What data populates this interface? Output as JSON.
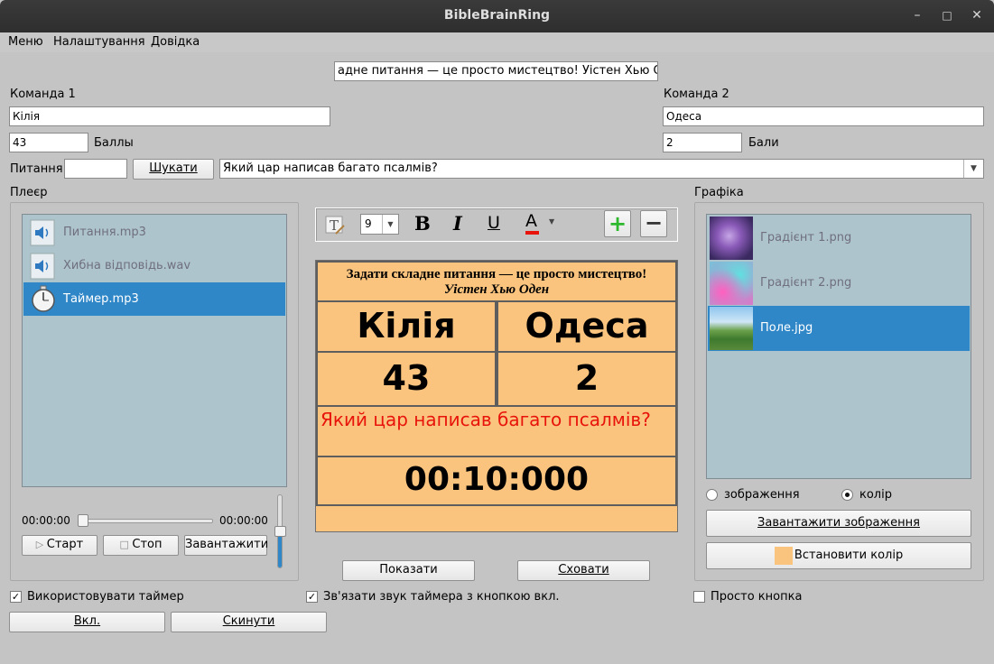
{
  "window": {
    "title": "BibleBrainRing"
  },
  "menu": [
    "Меню",
    "Налаштування",
    "Довідка"
  ],
  "quote_field": "адне питання — це просто мистецтво!  Уістен Хью Оден",
  "team1": {
    "label": "Команда 1",
    "name": "Кілія",
    "score": "43",
    "score_label": "Баллы"
  },
  "team2": {
    "label": "Команда 2",
    "name": "Одеса",
    "score": "2",
    "score_label": "Бали"
  },
  "question": {
    "label": "Питання",
    "number": "",
    "search_button": "Шукати",
    "text": "Який цар написав багато псалмів?"
  },
  "player": {
    "label": "Плеєр",
    "files": [
      {
        "name": "Питання.mp3",
        "icon": "speaker-icon"
      },
      {
        "name": "Хибна відповідь.wav",
        "icon": "speaker-icon"
      },
      {
        "name": "Таймер.mp3",
        "icon": "stopwatch-icon"
      }
    ],
    "selected_index": 2,
    "time_start": "00:00:00",
    "time_end": "00:00:00",
    "start_button": "Старт",
    "stop_button": "Стоп",
    "load_button": "Завантажити",
    "volume": 0.7
  },
  "toolbar": {
    "font_size": "9"
  },
  "scoreboard": {
    "quote_line1": "Задати складне питання — це просто мистецтво!",
    "quote_line2": "Уістен Хью Оден",
    "team1": "Кілія",
    "team2": "Одеса",
    "score1": "43",
    "score2": "2",
    "question": "Який цар написав багато псалмів?",
    "timer": "00:10:000",
    "colors": {
      "background": "#fac47e",
      "question_text": "#e8140c"
    }
  },
  "show_button": "Показати",
  "hide_button": "Сховати",
  "graphics": {
    "label": "Графіка",
    "images": [
      "Градієнт 1.png",
      "Градієнт 2.png",
      "Поле.jpg"
    ],
    "selected_index": 2,
    "radio_image": "зображення",
    "radio_color": "колір",
    "selected_radio": "колір",
    "load_image_button": "Завантажити зображення",
    "set_color_button": "Встановити колір",
    "swatch_color": "#fac47e"
  },
  "options": {
    "use_timer": "Використовувати таймер",
    "link_sound": "Зв'язати звук таймера з кнопкою вкл.",
    "simple_button": "Просто кнопка",
    "use_timer_checked": true,
    "link_sound_checked": true,
    "simple_button_checked": false
  },
  "bottom": {
    "on_button": "Вкл.",
    "reset_button": "Скинути"
  }
}
